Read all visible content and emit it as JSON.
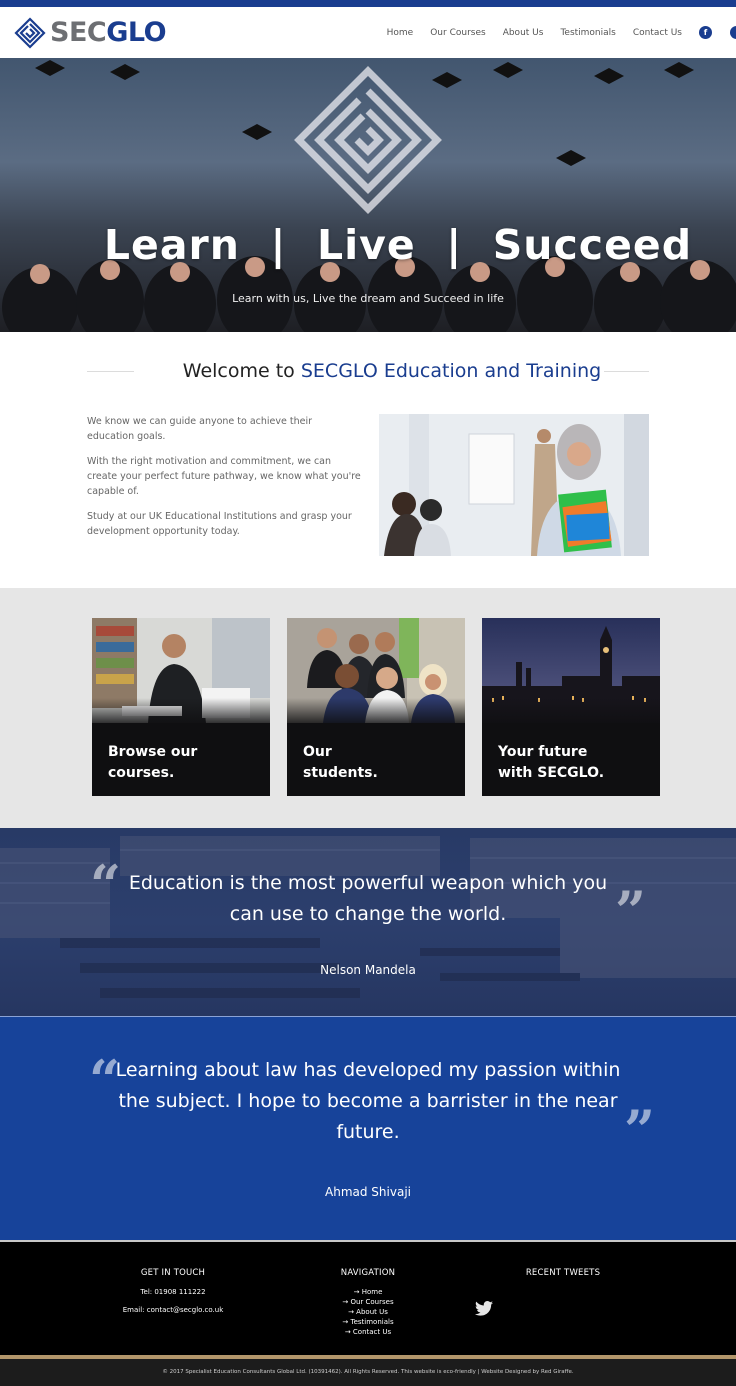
{
  "brand": {
    "logo_sec": "SEC",
    "logo_glo": "GLO",
    "accent": "#1a3d8f",
    "logo_grey": "#6d6f73"
  },
  "nav": {
    "items": [
      "Home",
      "Our Courses",
      "About Us",
      "Testimonials",
      "Contact Us"
    ],
    "facebook_label": "f",
    "facebook_icon": "facebook-icon",
    "twitter_icon": "twitter-icon"
  },
  "hero": {
    "title": "Learn  |  Live  |  Succeed",
    "subtitle": "Learn with us, Live the dream and Succeed in life"
  },
  "welcome": {
    "heading_prefix": "Welcome to ",
    "heading_brand": "SECGLO Education and Training",
    "paragraphs": [
      "We know we can guide anyone to achieve their education goals.",
      "With the right motivation and commitment, we can create your perfect future pathway, we know what you're capable of.",
      "Study at our UK Educational Institutions and grasp your development opportunity today."
    ]
  },
  "cards": [
    {
      "label": "Browse our\ncourses."
    },
    {
      "label": "Our\nstudents."
    },
    {
      "label": "Your future\nwith SECGLO."
    }
  ],
  "quote_one": {
    "text_line1": "Education is the most powerful weapon which you",
    "text_line2": "can use to change the world.",
    "author": "Nelson Mandela",
    "open_mark": "“",
    "close_mark": "”"
  },
  "quote_two": {
    "text_line1": "Learning about law has developed my passion within",
    "text_line2": "the subject. I hope to become a barrister in the near",
    "text_line3": "future.",
    "author": "Ahmad Shivaji",
    "open_mark": "“",
    "close_mark": "”"
  },
  "footer": {
    "contact_heading": "GET IN TOUCH",
    "tel": "Tel: 01908 111222",
    "email": "Email: contact@secglo.co.uk",
    "nav_heading": "NAVIGATION",
    "nav_links": [
      "→ Home",
      "→ Our Courses",
      "→ About Us",
      "→ Testimonials",
      "→ Contact Us"
    ],
    "tweets_heading": "RECENT TWEETS",
    "tweets_icon": "twitter-bird-icon",
    "legal": "© 2017 Specialist Education Consultants Global Ltd. (10391462). All Rights Reserved. This website is eco-friendly | Website Designed by Red Giraffe."
  }
}
